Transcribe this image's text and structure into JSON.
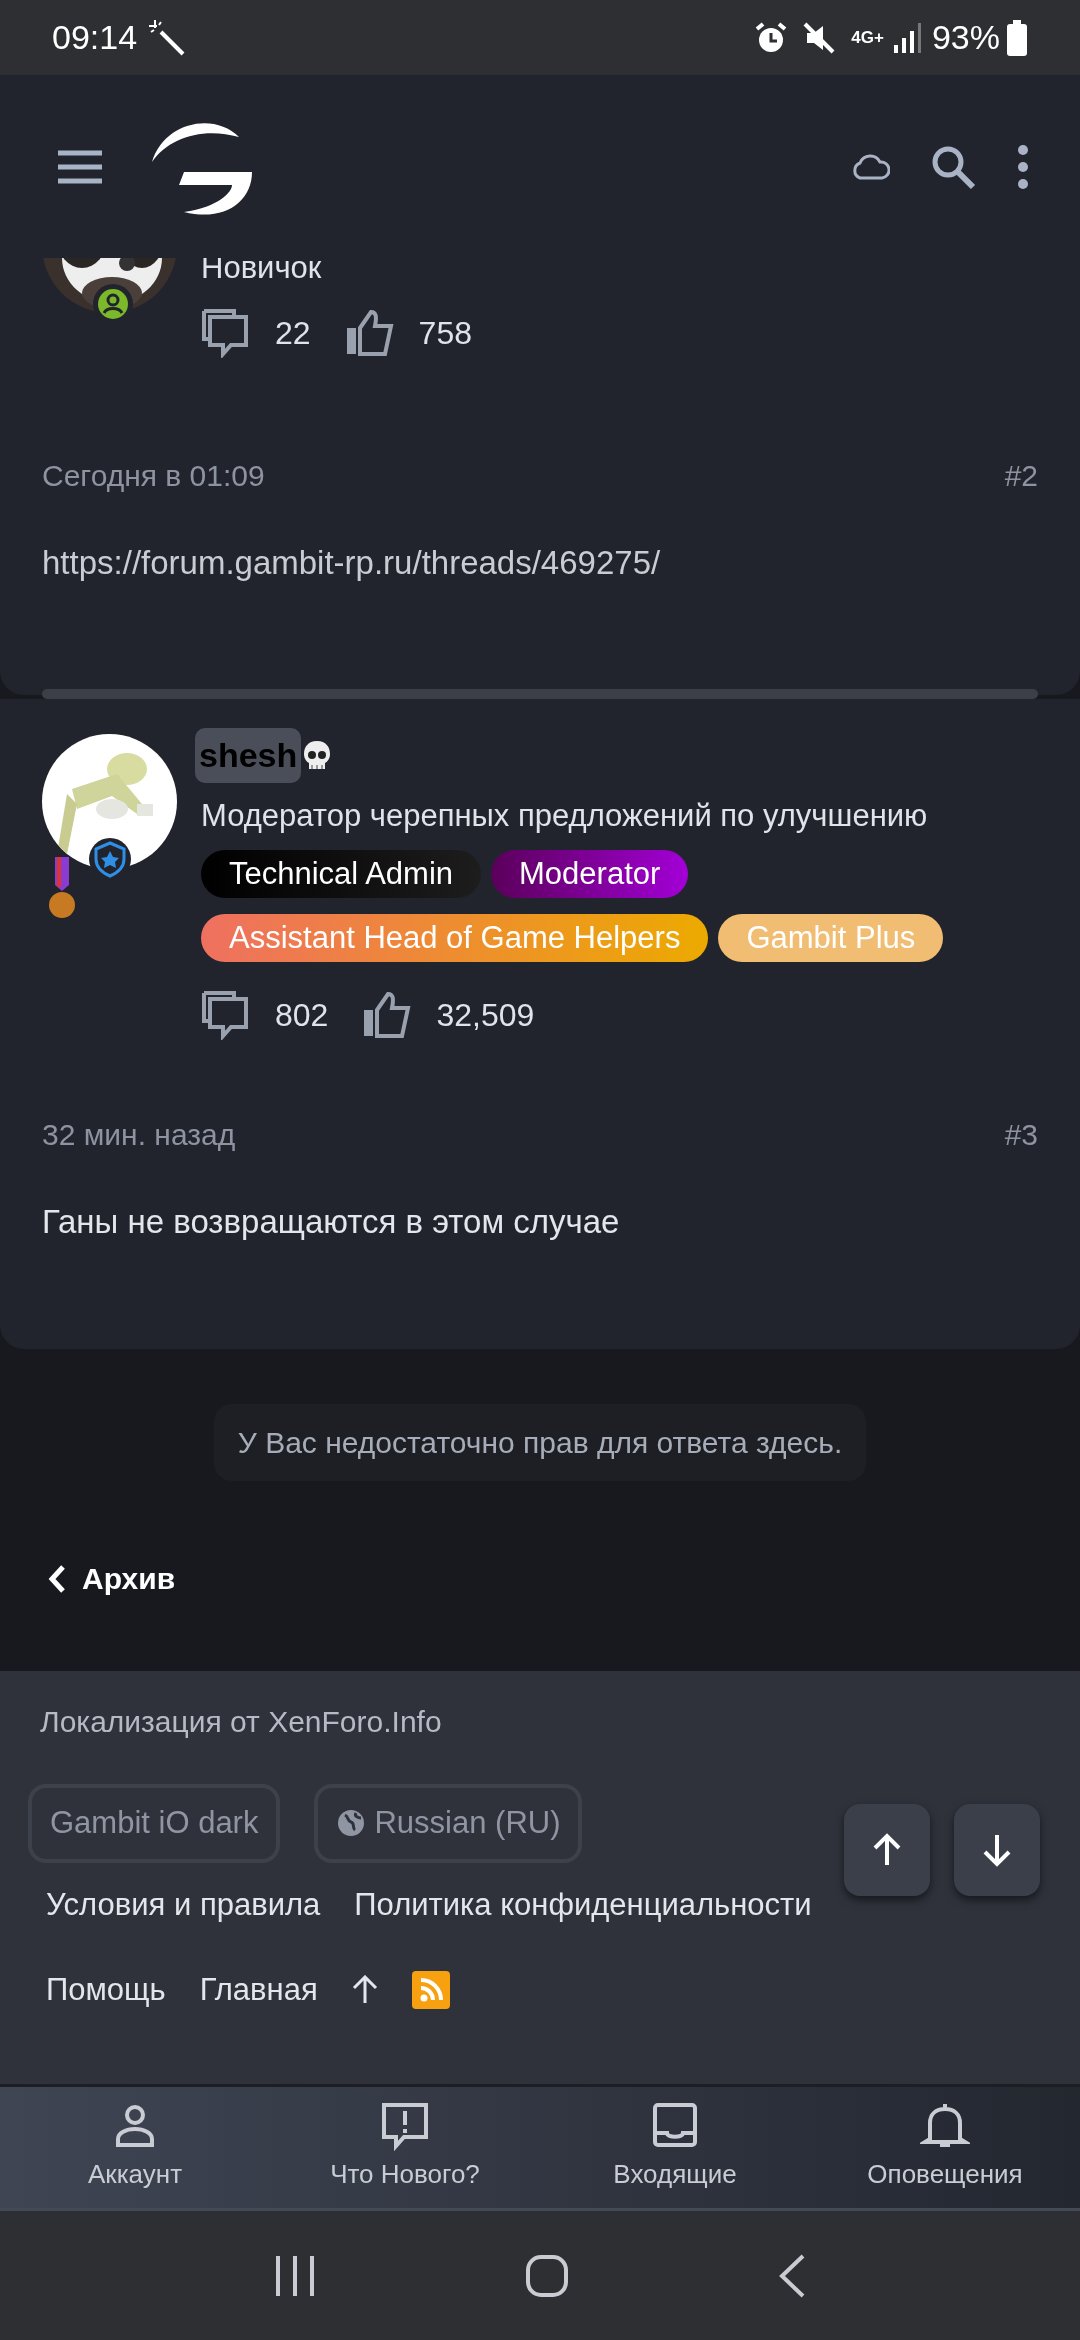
{
  "status_bar": {
    "time": "09:14",
    "network": "4G+",
    "battery": "93%"
  },
  "posts": [
    {
      "user_title": "Новичок",
      "stats": {
        "messages": "22",
        "reactions": "758"
      },
      "date": "Сегодня в 01:09",
      "number": "#2",
      "text": "https://forum.gambit-rp.ru/threads/469275/",
      "kind": "link"
    },
    {
      "username": "shesh",
      "user_title": "Модератор черепных предложений по улучшению",
      "banners": [
        {
          "label": "Technical Admin",
          "kind": "tech"
        },
        {
          "label": "Moderator",
          "kind": "moderator"
        },
        {
          "label": "Assistant Head of Game Helpers",
          "kind": "assistant"
        },
        {
          "label": "Gambit Plus",
          "kind": "plus"
        }
      ],
      "stats": {
        "messages": "802",
        "reactions": "32,509"
      },
      "date": "32 мин. назад",
      "number": "#3",
      "text": "Ганы не возвращаются в этом случае",
      "kind": "plain"
    }
  ],
  "notice": "У Вас недостаточно прав для ответа здесь.",
  "breadcrumb": "Архив",
  "footer": {
    "credit": "Локализация от XenForo.Info",
    "style_chooser": "Gambit iO dark",
    "language": "Russian (RU)",
    "links": [
      "Условия и правила",
      "Политика конфиденциальности"
    ],
    "links_2": [
      "Помощь",
      "Главная"
    ]
  },
  "bottom_nav": [
    {
      "label": "Аккаунт",
      "kind": "account"
    },
    {
      "label": "Что Нового?",
      "kind": "whatsnew"
    },
    {
      "label": "Входящие",
      "kind": "inbox"
    },
    {
      "label": "Оповещения",
      "kind": "alerts"
    }
  ]
}
